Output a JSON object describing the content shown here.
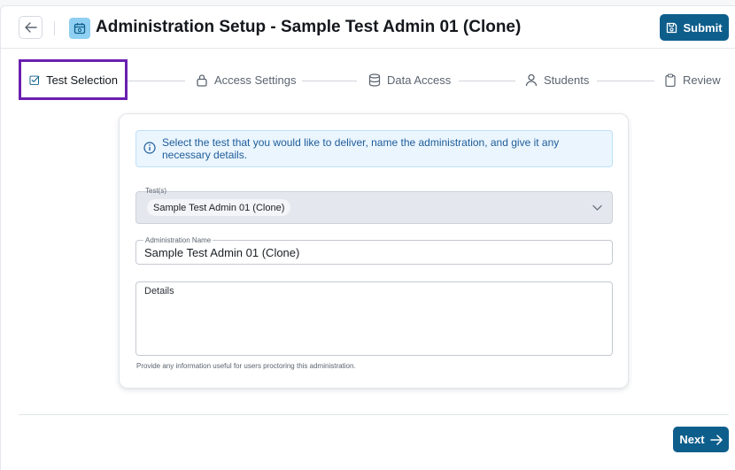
{
  "header": {
    "title": "Administration Setup - Sample Test Admin 01 (Clone)",
    "submit_label": "Submit"
  },
  "stepper": {
    "steps": [
      {
        "label": "Test Selection",
        "icon": "checkbox-icon",
        "active": true
      },
      {
        "label": "Access Settings",
        "icon": "lock-icon"
      },
      {
        "label": "Data Access",
        "icon": "database-icon"
      },
      {
        "label": "Students",
        "icon": "person-icon"
      },
      {
        "label": "Review",
        "icon": "clipboard-icon"
      }
    ]
  },
  "form": {
    "info_text": "Select the test that you would like to deliver, name the administration, and give it any necessary details.",
    "tests_label": "Test(s)",
    "tests_selected": "Sample Test Admin 01 (Clone)",
    "admin_name_label": "Administration Name",
    "admin_name_value": "Sample Test Admin 01 (Clone)",
    "details_label": "Details",
    "details_value": "",
    "helper_text": "Provide any information useful for users proctoring this administration."
  },
  "footer": {
    "next_label": "Next"
  },
  "colors": {
    "primary": "#0e5e8c",
    "active_step_border": "#6b1fb0",
    "info_bg": "#eaf5fe",
    "info_text": "#1e5d9a"
  }
}
